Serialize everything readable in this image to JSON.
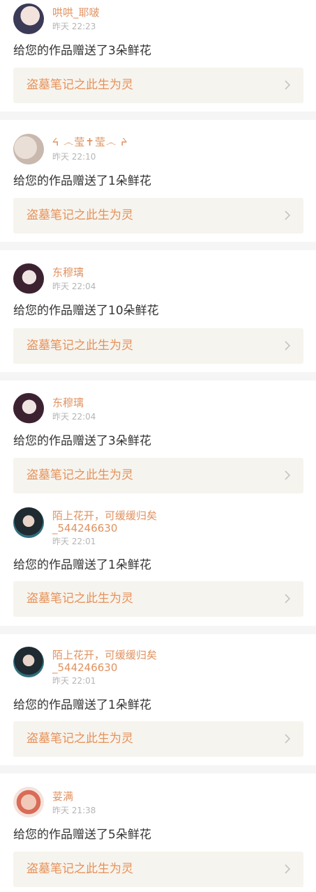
{
  "items": [
    {
      "user": "哄哄_耶啵",
      "time": "昨天 22:23",
      "message": "给您的作品赠送了3朵鲜花",
      "work_title": "盗墓笔记之此生为灵"
    },
    {
      "user": "ᔦ ෴莹✝莹෴ ᔨ",
      "time": "昨天 22:10",
      "message": "给您的作品赠送了1朵鲜花",
      "work_title": "盗墓笔记之此生为灵"
    },
    {
      "user": "东穆璃",
      "time": "昨天 22:04",
      "message": "给您的作品赠送了10朵鲜花",
      "work_title": "盗墓笔记之此生为灵"
    },
    {
      "user": "东穆璃",
      "time": "昨天 22:04",
      "message": "给您的作品赠送了3朵鲜花",
      "work_title": "盗墓笔记之此生为灵"
    },
    {
      "user_line1": "陌上花开，可缓缓归矣",
      "user_line2": "_544246630",
      "time": "昨天 22:01",
      "message": "给您的作品赠送了1朵鲜花",
      "work_title": "盗墓笔记之此生为灵"
    },
    {
      "user_line1": "陌上花开，可缓缓归矣",
      "user_line2": "_544246630",
      "time": "昨天 22:01",
      "message": "给您的作品赠送了1朵鲜花",
      "work_title": "盗墓笔记之此生为灵"
    },
    {
      "user": "荽满",
      "time": "昨天 21:38",
      "message": "给您的作品赠送了5朵鲜花",
      "work_title": "盗墓笔记之此生为灵"
    }
  ],
  "icons": {
    "avatar": "avatar-image",
    "chevron": "chevron-right-icon"
  },
  "colors": {
    "name": "#e09260",
    "work_title": "#e6915a",
    "work_bg": "#f6f4ee",
    "separator": "#f5f5f5",
    "time": "#b5b5b5",
    "message": "#333333"
  }
}
